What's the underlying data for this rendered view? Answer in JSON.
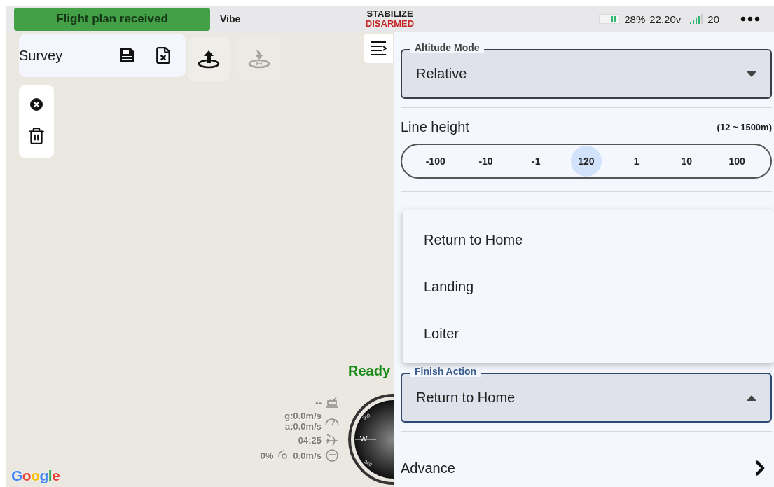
{
  "status_bar": {
    "message": "Flight plan received",
    "vibe": "Vibe",
    "mode": "STABILIZE",
    "arm_state": "DISARMED",
    "battery_percent": "28%",
    "voltage": "22.20v",
    "satellites": "20"
  },
  "map": {
    "mission_name": "Survey",
    "tools": [
      {
        "kind": "upload",
        "disabled": false
      },
      {
        "kind": "home-download",
        "disabled": true
      }
    ],
    "status": "Ready",
    "telemetry": [
      {
        "kind": "distance",
        "texts": [
          "--"
        ]
      },
      {
        "kind": "speed",
        "texts": [
          "g:0.0m/s",
          "a:0.0m/s"
        ]
      },
      {
        "kind": "time",
        "texts": [
          "04:25"
        ]
      },
      {
        "kind": "throttle",
        "texts": [
          "0%",
          "0.0m/s"
        ]
      }
    ],
    "compass_labels": [
      "300",
      "W",
      "240"
    ],
    "attribution": "Google"
  },
  "panel": {
    "altitude_mode": {
      "label": "Altitude Mode",
      "value": "Relative",
      "expanded": false
    },
    "line_height": {
      "label": "Line height",
      "range": "(12 ~ 1500m)",
      "steps": [
        {
          "label": "-100",
          "selected": false
        },
        {
          "label": "-10",
          "selected": false
        },
        {
          "label": "-1",
          "selected": false
        },
        {
          "label": "120",
          "selected": true
        },
        {
          "label": "1",
          "selected": false
        },
        {
          "label": "10",
          "selected": false
        },
        {
          "label": "100",
          "selected": false
        }
      ]
    },
    "finish_action": {
      "label": "Finish Action",
      "value": "Return to Home",
      "expanded": true,
      "options": [
        {
          "label": "Return to Home"
        },
        {
          "label": "Landing"
        },
        {
          "label": "Loiter"
        }
      ]
    },
    "advance": {
      "label": "Advance"
    }
  }
}
